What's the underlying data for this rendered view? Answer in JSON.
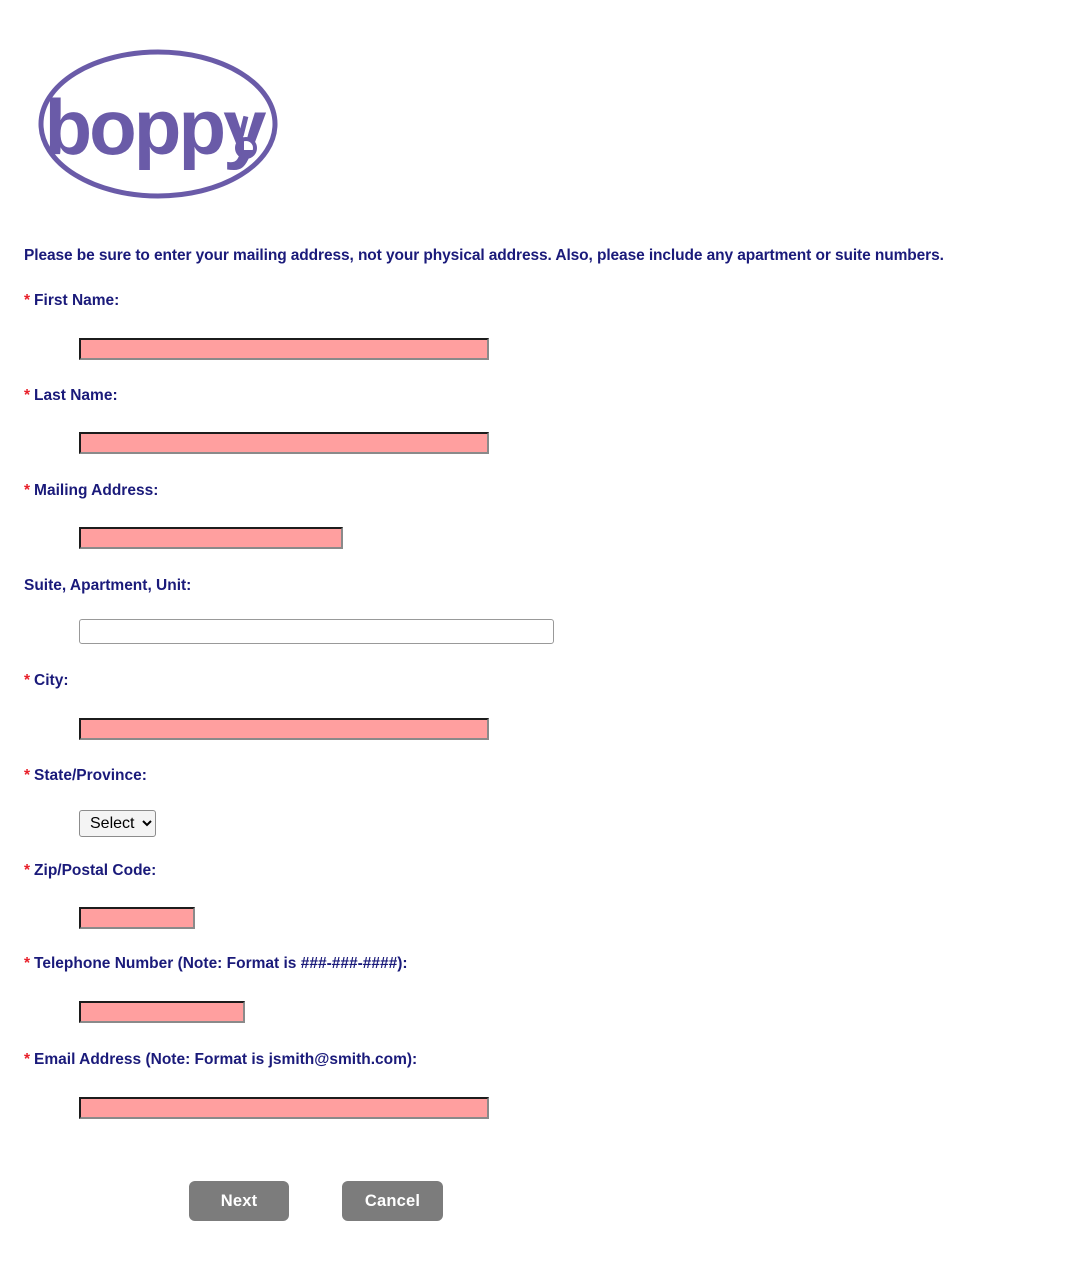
{
  "brand": {
    "logo_text": "boppy",
    "logo_mark": "registered-mark",
    "logo_color": "#6a5ba8"
  },
  "instructions": "Please be sure to enter your mailing address, not your physical address. Also, please include any apartment or suite numbers.",
  "colors": {
    "label_blue": "#1a1a7a",
    "required_star_red": "#e8202a",
    "required_field_fill": "#ff9f9f",
    "button_grey": "#7c7c7c",
    "logo_purple": "#6a5ba8"
  },
  "required_marker": "*",
  "fields": [
    {
      "id": "first-name",
      "label": "First Name:",
      "required": true,
      "value": "",
      "placeholder": "",
      "type": "text",
      "style": "required"
    },
    {
      "id": "last-name",
      "label": "Last Name:",
      "required": true,
      "value": "",
      "placeholder": "",
      "type": "text",
      "style": "required"
    },
    {
      "id": "mailing-address",
      "label": "Mailing Address:",
      "required": true,
      "value": "",
      "placeholder": "",
      "type": "text",
      "style": "required"
    },
    {
      "id": "suite-apartment-unit",
      "label": "Suite, Apartment, Unit:",
      "required": false,
      "value": "",
      "placeholder": "",
      "type": "text",
      "style": "optional"
    },
    {
      "id": "city",
      "label": "City:",
      "required": true,
      "value": "",
      "placeholder": "",
      "type": "text",
      "style": "required"
    },
    {
      "id": "state-province",
      "label": "State/Province:",
      "required": true,
      "value": "Select",
      "placeholder": "",
      "type": "select",
      "style": "select",
      "options": [
        "Select"
      ]
    },
    {
      "id": "zip-postal-code",
      "label": "Zip/Postal Code:",
      "required": true,
      "value": "",
      "placeholder": "",
      "type": "text",
      "style": "required"
    },
    {
      "id": "telephone-number",
      "label": "Telephone Number (Note: Format is ###-###-####):",
      "required": true,
      "value": "",
      "placeholder": "",
      "type": "text",
      "style": "required"
    },
    {
      "id": "email-address",
      "label": "Email Address (Note: Format is jsmith@smith.com):",
      "required": true,
      "value": "",
      "placeholder": "",
      "type": "text",
      "style": "required"
    }
  ],
  "buttons": {
    "next_label": "Next",
    "cancel_label": "Cancel"
  }
}
